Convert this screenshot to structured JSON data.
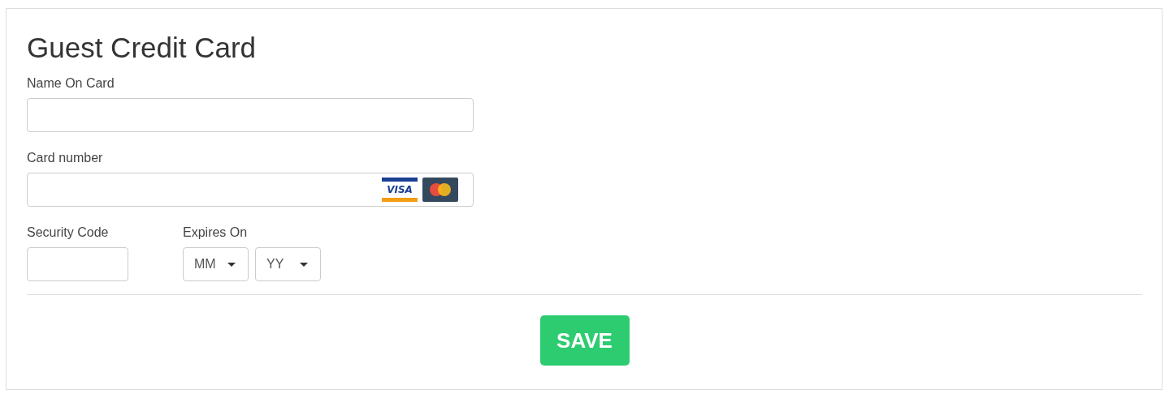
{
  "title": "Guest Credit Card",
  "fields": [
    {
      "kind": "text",
      "label": "Name On Card"
    },
    {
      "kind": "card",
      "label": "Card number",
      "logos": [
        {
          "kind": "visa",
          "text": "VISA"
        },
        {
          "kind": "mastercard"
        }
      ]
    }
  ],
  "security_code": {
    "label": "Security Code"
  },
  "expires": {
    "label": "Expires On",
    "selects": [
      "MM",
      "YY"
    ]
  },
  "save_button": "SAVE"
}
